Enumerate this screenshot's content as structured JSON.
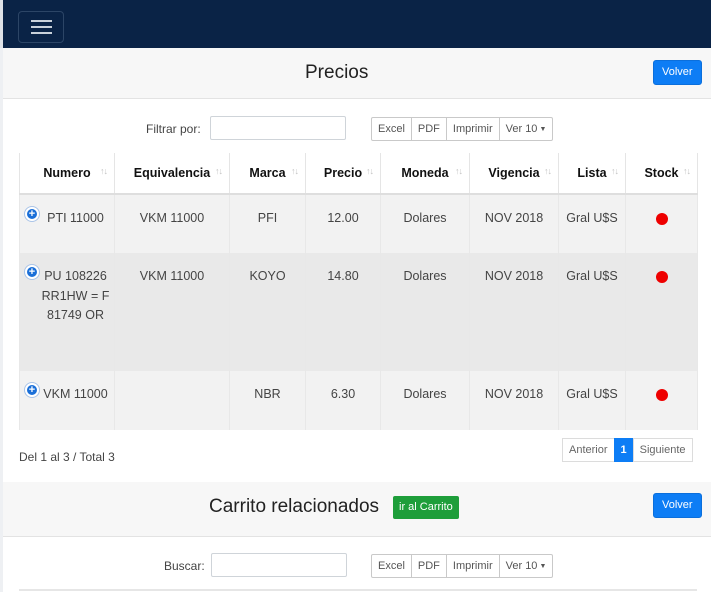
{
  "navbar": {
    "menu_icon": "hamburger-menu-icon"
  },
  "prices": {
    "title": "Precios",
    "back_label": "Volver",
    "filter_label": "Filtrar por:",
    "filter_value": "",
    "export_buttons": [
      "Excel",
      "PDF",
      "Imprimir"
    ],
    "page_length_label": "Ver 10",
    "columns": [
      "Numero",
      "Equivalencia",
      "Marca",
      "Precio",
      "Moneda",
      "Vigencia",
      "Lista",
      "Stock"
    ],
    "rows": [
      {
        "numero": "PTI 11000",
        "equivalencia": "VKM 11000",
        "marca": "PFI",
        "precio": "12.00",
        "moneda": "Dolares",
        "vigencia": "NOV 2018",
        "lista": "Gral U$S",
        "stock_color": "#ee0000"
      },
      {
        "numero": "PU 108226 RR1HW = F 81749 OR",
        "equivalencia": "VKM 11000",
        "marca": "KOYO",
        "precio": "14.80",
        "moneda": "Dolares",
        "vigencia": "NOV 2018",
        "lista": "Gral U$S",
        "stock_color": "#ee0000"
      },
      {
        "numero": "VKM 11000",
        "equivalencia": "",
        "marca": "NBR",
        "precio": "6.30",
        "moneda": "Dolares",
        "vigencia": "NOV 2018",
        "lista": "Gral U$S",
        "stock_color": "#ee0000"
      }
    ],
    "info": "Del 1 al 3 / Total 3",
    "pagination": {
      "previous": "Anterior",
      "current": "1",
      "next": "Siguiente"
    }
  },
  "cart": {
    "title": "Carrito relacionados",
    "go_to_cart_label": "ir al Carrito",
    "back_label": "Volver",
    "search_label": "Buscar:",
    "search_value": "",
    "export_buttons": [
      "Excel",
      "PDF",
      "Imprimir"
    ],
    "page_length_label": "Ver 10"
  },
  "colors": {
    "navbar": "#0a2346",
    "primary": "#0d7df5",
    "success": "#1e9e3a",
    "stock_out": "#ee0000"
  }
}
